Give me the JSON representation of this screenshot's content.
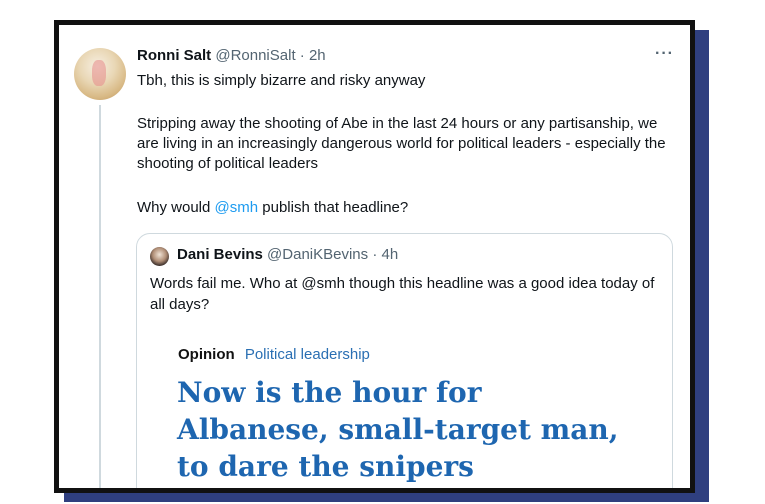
{
  "tweet": {
    "author_name": "Ronni Salt",
    "author_handle": "@RonniSalt",
    "time": "· 2h",
    "more_label": "···",
    "line1": "Tbh, this is simply bizarre and risky anyway",
    "para2": "Stripping away the shooting of Abe in the last 24 hours or any partisanship, we are living in an increasingly dangerous world for political leaders - especially the shooting of political leaders",
    "para3_prefix": "Why would ",
    "para3_mention": "@smh",
    "para3_suffix": " publish that headline?"
  },
  "quote": {
    "author_name": "Dani Bevins",
    "author_handle": "@DaniKBevins",
    "time": "· 4h",
    "text": "Words fail me. Who at @smh though this headline was a good idea today of all days?",
    "article_label": "Opinion",
    "article_category": "Political leadership",
    "headline": "Now is the hour for Albanese, small-target man, to dare the snipers"
  }
}
